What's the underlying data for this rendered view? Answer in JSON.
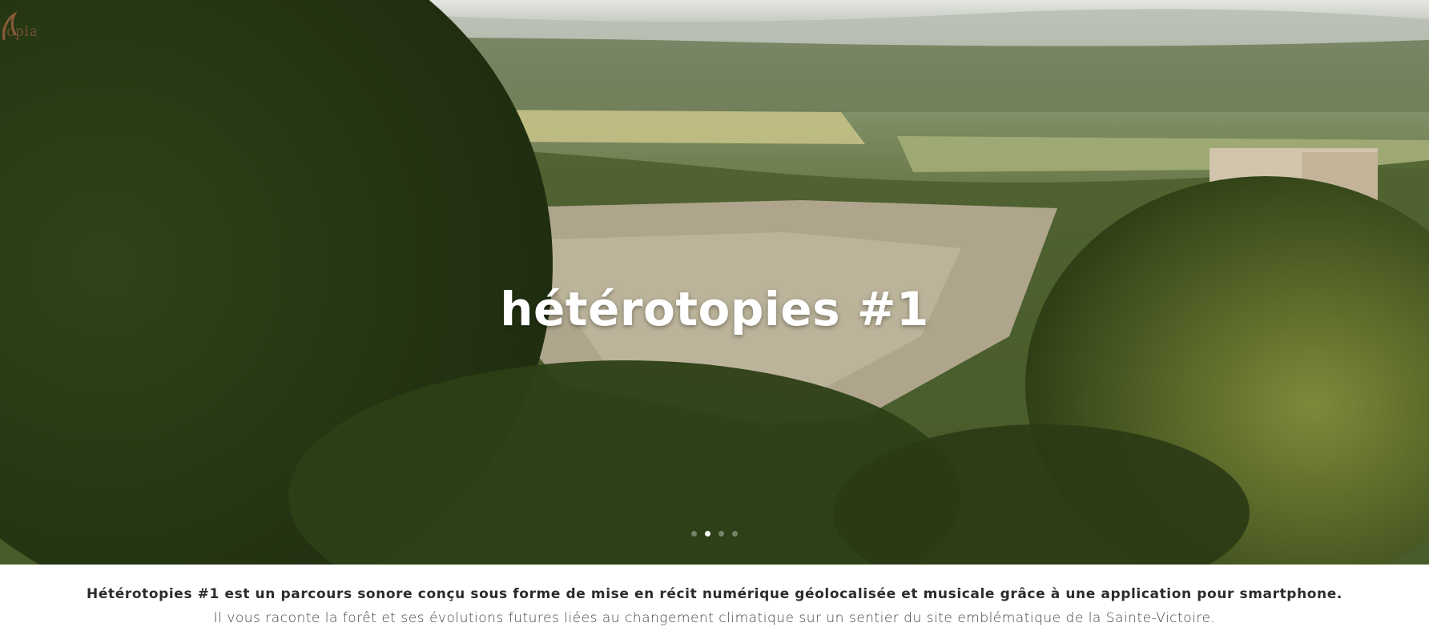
{
  "header": {
    "logo_text": "topia"
  },
  "hero": {
    "title": "hétérotopies #1",
    "carousel": {
      "slide_count": 4,
      "active_index": 1
    }
  },
  "intro": {
    "lead": "Hétérotopies #1 est un parcours sonore conçu sous forme de mise en récit numérique géolocalisée et musicale grâce à une application pour smartphone.",
    "sub": "Il vous raconte la forêt et ses évolutions futures liées au changement climatique sur un sentier du site emblématique de la Sainte-Victoire."
  },
  "colors": {
    "accent": "#8a5a3a",
    "text_dark": "#2b2b2b",
    "text_muted": "#444444",
    "background": "#ffffff"
  }
}
